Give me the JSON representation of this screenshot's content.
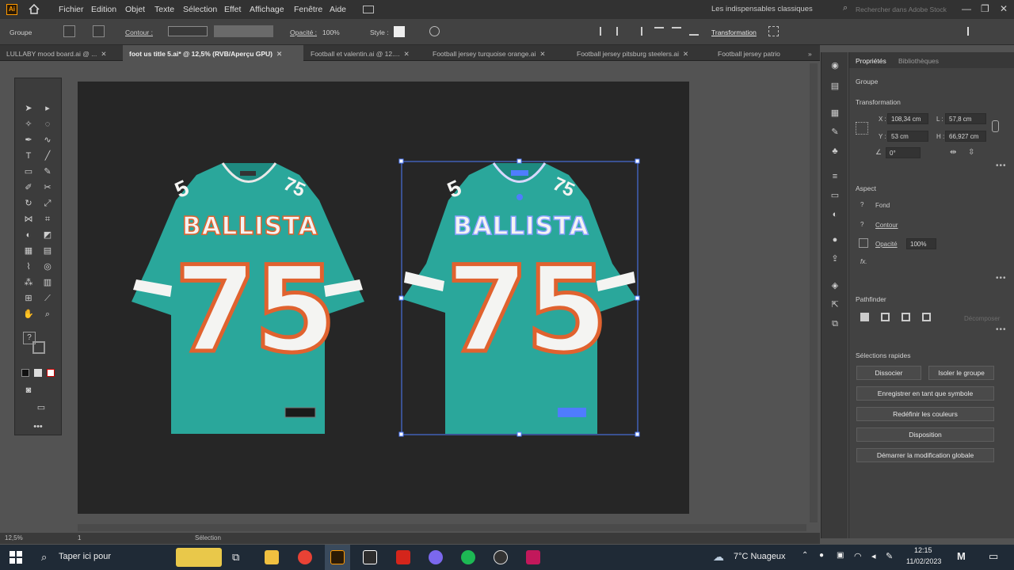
{
  "menu": {
    "items": [
      "Fichier",
      "Edition",
      "Objet",
      "Texte",
      "Sélection",
      "Effet",
      "Affichage",
      "Fenêtre",
      "Aide"
    ],
    "workspace": "Les indispensables classiques",
    "search_placeholder": "Rechercher dans Adobe Stock"
  },
  "control": {
    "type_label": "Groupe",
    "stroke_label": "Contour :",
    "opacity_label": "Opacité :",
    "opacity_value": "100%",
    "style_label": "Style :",
    "transform_label": "Transformation"
  },
  "tabs": [
    {
      "label": "LULLABY mood board.ai @ ...",
      "active": false
    },
    {
      "label": "foot us title 5.ai* @ 12,5% (RVB/Aperçu GPU)",
      "active": true
    },
    {
      "label": "Football et valentin.ai @ 12....",
      "active": false
    },
    {
      "label": "Football jersey turquoise orange.ai",
      "active": false
    },
    {
      "label": "Football jersey pitsburg steelers.ai",
      "active": false
    },
    {
      "label": "Football jersey patrio",
      "active": false
    }
  ],
  "jerseys": [
    {
      "team": "BALLISTA",
      "number": "75",
      "shoulder_left": "5",
      "shoulder_right": "75"
    },
    {
      "team": "BALLISTA",
      "number": "75",
      "shoulder_left": "5",
      "shoulder_right": "75"
    }
  ],
  "properties": {
    "tabs": [
      "Propriétés",
      "Bibliothèques"
    ],
    "selection_type": "Groupe",
    "transform": {
      "header": "Transformation",
      "x_label": "X :",
      "x": "108,34 cm",
      "y_label": "Y :",
      "y": "53 cm",
      "w_label": "L :",
      "w": "57,8 cm",
      "h_label": "H :",
      "h": "66,927 cm",
      "angle": "0°"
    },
    "aspect": {
      "header": "Aspect",
      "fill_label": "Fond",
      "stroke_label": "Contour",
      "opacity_label": "Opacité",
      "opacity": "100%",
      "fx": "fx."
    },
    "pathfinder": {
      "header": "Pathfinder",
      "expand": "Décomposer"
    },
    "quick_actions": {
      "header": "Sélections rapides",
      "ungroup": "Dissocier",
      "isolate": "Isoler le groupe",
      "save_symbol": "Enregistrer en tant que symbole",
      "recolor": "Redéfinir les couleurs",
      "arrange": "Disposition",
      "global_edit": "Démarrer la modification globale"
    }
  },
  "status": {
    "zoom": "12,5%",
    "artboard": "1",
    "tool": "Sélection"
  },
  "taskbar": {
    "search": "Taper ici pour",
    "weather": "7°C Nuageux",
    "time": "12:15",
    "date": "11/02/2023"
  },
  "colors": {
    "teal": "#2aa79b",
    "orange": "#e0622f",
    "white": "#f4f4f2",
    "artboard": "#262626",
    "selection": "#4f7cff"
  }
}
